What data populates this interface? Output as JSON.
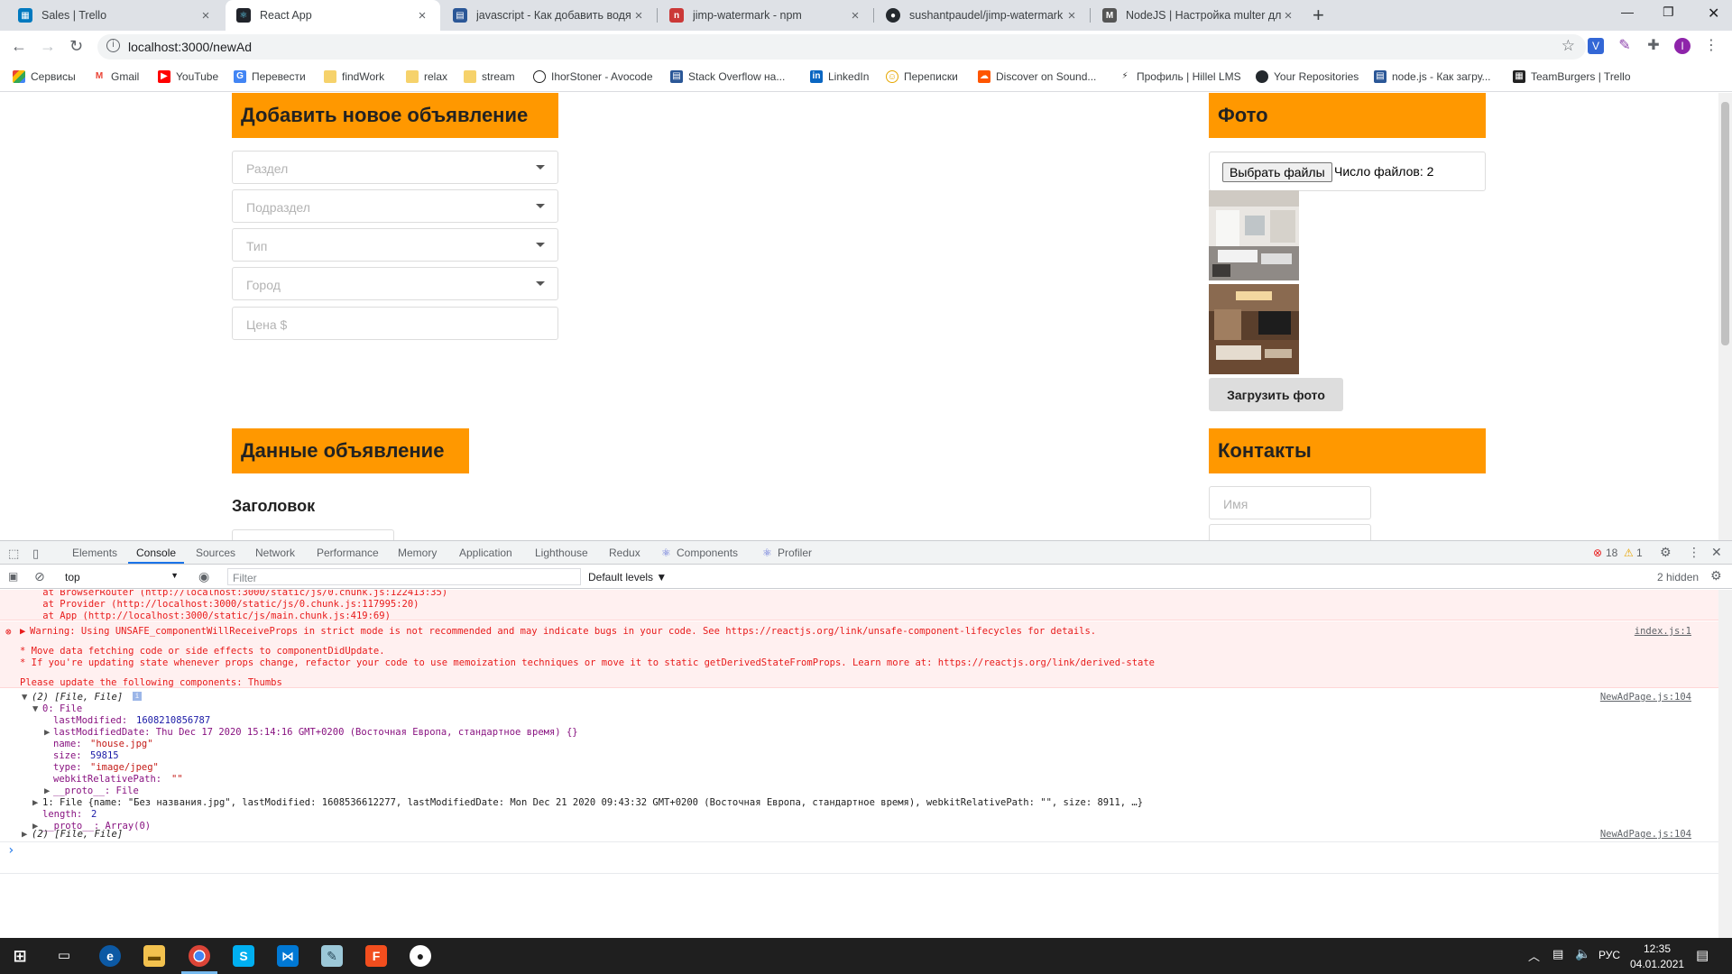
{
  "tabs": [
    {
      "title": "Sales | Trello",
      "favicon": "trello-icon"
    },
    {
      "title": "React App",
      "favicon": "react-icon"
    },
    {
      "title": "javascript - Как добавить водяной знак",
      "favicon": "stackoverflow-icon"
    },
    {
      "title": "jimp-watermark - npm",
      "favicon": "npm-icon"
    },
    {
      "title": "sushantpaudel/jimp-watermark",
      "favicon": "github-icon"
    },
    {
      "title": "NodeJS | Настройка multer для",
      "favicon": "metanit-icon"
    }
  ],
  "address": {
    "url": "localhost:3000/newAd"
  },
  "bookmarks": [
    "Сервисы",
    "Gmail",
    "YouTube",
    "Перевести",
    "findWork",
    "relax",
    "stream",
    "IhorStoner - Avocode",
    "Stack Overflow на...",
    "LinkedIn",
    "Переписки",
    "Discover on Sound...",
    "Профиль | Hillel LMS",
    "Your Repositories",
    "node.js - Как загру...",
    "TeamBurgers | Trello"
  ],
  "form": {
    "new_ad_heading": "Добавить новое объявление",
    "section_placeholder": "Раздел",
    "subsection_placeholder": "Подраздел",
    "type_placeholder": "Тип",
    "city_placeholder": "Город",
    "price_placeholder": "Цена $",
    "ad_data_heading": "Данные объявление",
    "title_label": "Заголовок"
  },
  "photo": {
    "heading": "Фото",
    "choose_files": "Выбрать файлы",
    "file_count": "Число файлов: 2",
    "upload_button": "Загрузить фото"
  },
  "contacts": {
    "heading": "Контакты",
    "name_placeholder": "Имя"
  },
  "devtools": {
    "tabs": [
      "Elements",
      "Console",
      "Sources",
      "Network",
      "Performance",
      "Memory",
      "Application",
      "Lighthouse",
      "Redux",
      "Components",
      "Profiler"
    ],
    "errors": "18",
    "warnings": "1",
    "context": "top",
    "filter_placeholder": "Filter",
    "levels": "Default levels ▼",
    "hidden": "2 hidden"
  },
  "console": {
    "stack_lines": [
      "    at BrowserRouter (http://localhost:3000/static/js/0.chunk.js:122413:35)",
      "    at Provider (http://localhost:3000/static/js/0.chunk.js:117995:20)",
      "    at App (http://localhost:3000/static/js/main.chunk.js:419:69)"
    ],
    "warning_line": "Warning: Using UNSAFE_componentWillReceiveProps in strict mode is not recommended and may indicate bugs in your code. See https://reactjs.org/link/unsafe-component-lifecycles for details.",
    "warning_src": "index.js:1",
    "bullet1": "* Move data fetching code or side effects to componentDidUpdate.",
    "bullet2": "* If you're updating state whenever props change, refactor your code to use memoization techniques or move it to static getDerivedStateFromProps. Learn more at: https://reactjs.org/link/derived-state",
    "update_line": "Please update the following components: Thumbs",
    "log_header": "(2) [File, File]",
    "log_src": "NewAdPage.js:104",
    "file0": "0: File",
    "last_modified_key": "lastModified: ",
    "last_modified_val": "1608210856787",
    "last_modified_date": "lastModifiedDate: Thu Dec 17 2020 15:14:16 GMT+0200 (Восточная Европа, стандартное время) {}",
    "name_key": "name: ",
    "name_val": "\"house.jpg\"",
    "size_key": "size: ",
    "size_val": "59815",
    "type_key": "type: ",
    "type_val": "\"image/jpeg\"",
    "wrp_key": "webkitRelativePath: ",
    "wrp_val": "\"\"",
    "proto_file": "__proto__: File",
    "file1": "1: File {name: \"Без названия.jpg\", lastModified: 1608536612277, lastModifiedDate: Mon Dec 21 2020 09:43:32 GMT+0200 (Восточная Европа, стандартное время), webkitRelativePath: \"\", size: 8911, …}",
    "length_key": "length: ",
    "length_val": "2",
    "proto_array": "__proto__: Array(0)",
    "log2_header": "(2) [File, File]",
    "log2_src": "NewAdPage.js:104",
    "prompt": "›"
  },
  "taskbar": {
    "lang": "РУС",
    "time": "12:35",
    "date": "04.01.2021"
  },
  "colors": {
    "accent_orange": "#ff9800",
    "console_error": "#e81b1b",
    "chrome_tabstrip": "#dee1e6"
  }
}
